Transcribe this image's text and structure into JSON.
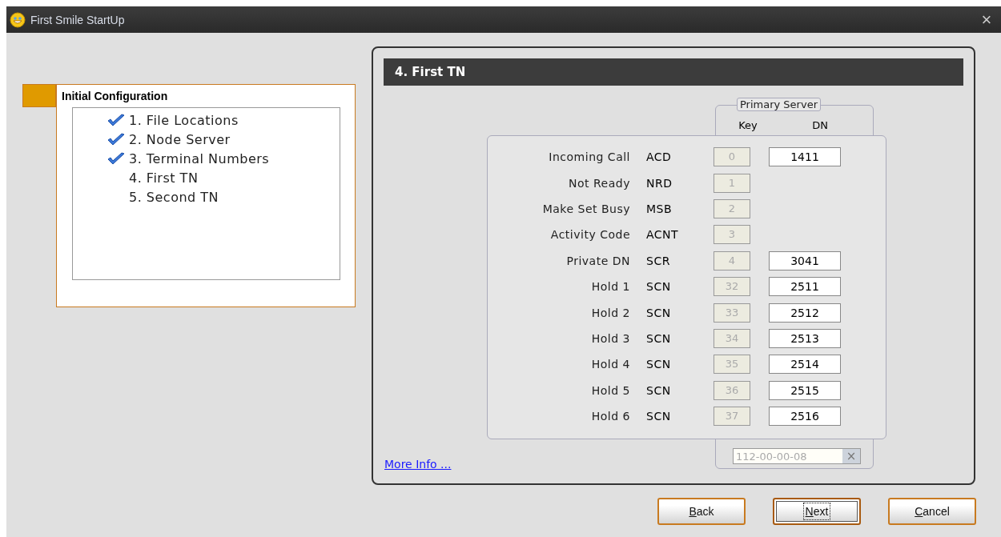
{
  "window": {
    "title": "First Smile StartUp",
    "close": "×"
  },
  "sidebar": {
    "title": "Initial Configuration",
    "steps": [
      {
        "label": "1. File Locations",
        "checked": true
      },
      {
        "label": "2. Node Server",
        "checked": true
      },
      {
        "label": "3. Terminal Numbers",
        "checked": true
      },
      {
        "label": "4. First TN",
        "checked": false
      },
      {
        "label": "5. Second TN",
        "checked": false
      }
    ]
  },
  "panel": {
    "title": "4. First TN",
    "group_title": "Primary Server",
    "columns": [
      "Key",
      "DN"
    ],
    "rows": [
      {
        "label": "Incoming Call",
        "code": "ACD",
        "key": "0",
        "dn": "1411"
      },
      {
        "label": "Not Ready",
        "code": "NRD",
        "key": "1"
      },
      {
        "label": "Make Set Busy",
        "code": "MSB",
        "key": "2"
      },
      {
        "label": "Activity Code",
        "code": "ACNT",
        "key": "3"
      },
      {
        "label": "Private DN",
        "code": "SCR",
        "key": "4",
        "dn": "3041"
      },
      {
        "label": "Hold 1",
        "code": "SCN",
        "key": "32",
        "dn": "2511"
      },
      {
        "label": "Hold 2",
        "code": "SCN",
        "key": "33",
        "dn": "2512"
      },
      {
        "label": "Hold 3",
        "code": "SCN",
        "key": "34",
        "dn": "2513"
      },
      {
        "label": "Hold 4",
        "code": "SCN",
        "key": "35",
        "dn": "2514"
      },
      {
        "label": "Hold 5",
        "code": "SCN",
        "key": "36",
        "dn": "2515"
      },
      {
        "label": "Hold 6",
        "code": "SCN",
        "key": "37",
        "dn": "2516"
      }
    ],
    "tn": "112-00-00-08",
    "clear": "×",
    "link": "More Info ..."
  },
  "buttons": [
    {
      "label": "Back",
      "focused": false
    },
    {
      "label": "Next",
      "focused": true
    },
    {
      "label": "Cancel",
      "focused": false
    }
  ]
}
